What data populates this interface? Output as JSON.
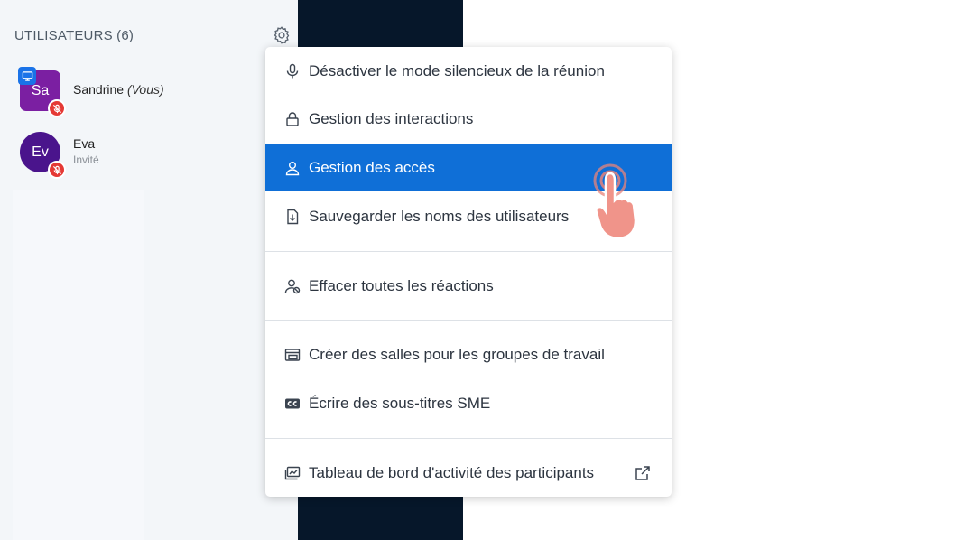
{
  "sidebar": {
    "header": "UTILISATEURS (6)",
    "users": [
      {
        "initials": "Sa",
        "name": "Sandrine",
        "suffix": "(Vous)",
        "role": ""
      },
      {
        "initials": "Ev",
        "name": "Eva",
        "suffix": "",
        "role": "Invité"
      }
    ]
  },
  "menu": {
    "items": [
      {
        "label": "Désactiver le mode silencieux de la réunion",
        "icon": "microphone-icon"
      },
      {
        "label": "Gestion des interactions",
        "icon": "lock-icon"
      },
      {
        "label": "Gestion des accès",
        "icon": "user-icon",
        "active": true
      },
      {
        "label": "Sauvegarder les noms des utilisateurs",
        "icon": "download-file-icon"
      },
      {
        "label": "Effacer toutes les réactions",
        "icon": "user-clear-icon"
      },
      {
        "label": "Créer des salles pour les groupes de travail",
        "icon": "breakout-rooms-icon"
      },
      {
        "label": "Écrire des sous-titres SME",
        "icon": "closed-captions-icon"
      },
      {
        "label": "Tableau de bord d'activité des participants",
        "icon": "dashboard-icon"
      }
    ]
  },
  "colors": {
    "active_bg": "#0f6fd7",
    "dark_panel": "#06172a",
    "avatar_sandrine": "#7b1fa2",
    "avatar_eva": "#4a148c",
    "mute_badge": "#e53935",
    "presenter_badge": "#1a73e8"
  }
}
